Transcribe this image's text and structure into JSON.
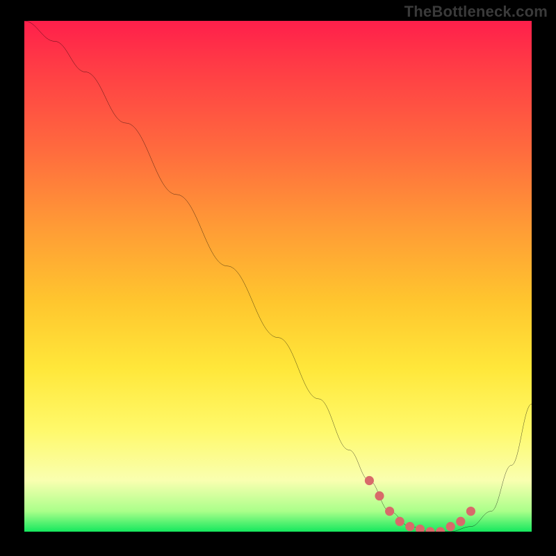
{
  "watermark": "TheBottleneck.com",
  "chart_data": {
    "type": "line",
    "title": "",
    "xlabel": "",
    "ylabel": "",
    "xlim": [
      0,
      100
    ],
    "ylim": [
      0,
      100
    ],
    "series": [
      {
        "name": "curve",
        "x": [
          0,
          6,
          12,
          20,
          30,
          40,
          50,
          58,
          64,
          68,
          72,
          76,
          80,
          84,
          88,
          92,
          96,
          100
        ],
        "y": [
          100,
          96,
          90,
          80,
          66,
          52,
          38,
          26,
          16,
          10,
          4,
          1,
          0,
          0,
          1,
          4,
          13,
          25
        ]
      }
    ],
    "markers": {
      "name": "highlight-dots",
      "color": "#d86a6a",
      "x": [
        68,
        70,
        72,
        74,
        76,
        78,
        80,
        82,
        84,
        86,
        88
      ],
      "y": [
        10,
        7,
        4,
        2,
        1,
        0.5,
        0,
        0,
        1,
        2,
        4
      ]
    },
    "gradient_stops": [
      {
        "pos": 0.0,
        "color": "#ff1f4b"
      },
      {
        "pos": 0.25,
        "color": "#ff6a3e"
      },
      {
        "pos": 0.55,
        "color": "#ffc62e"
      },
      {
        "pos": 0.8,
        "color": "#fff96a"
      },
      {
        "pos": 0.96,
        "color": "#aaff8a"
      },
      {
        "pos": 1.0,
        "color": "#15e85e"
      }
    ]
  }
}
